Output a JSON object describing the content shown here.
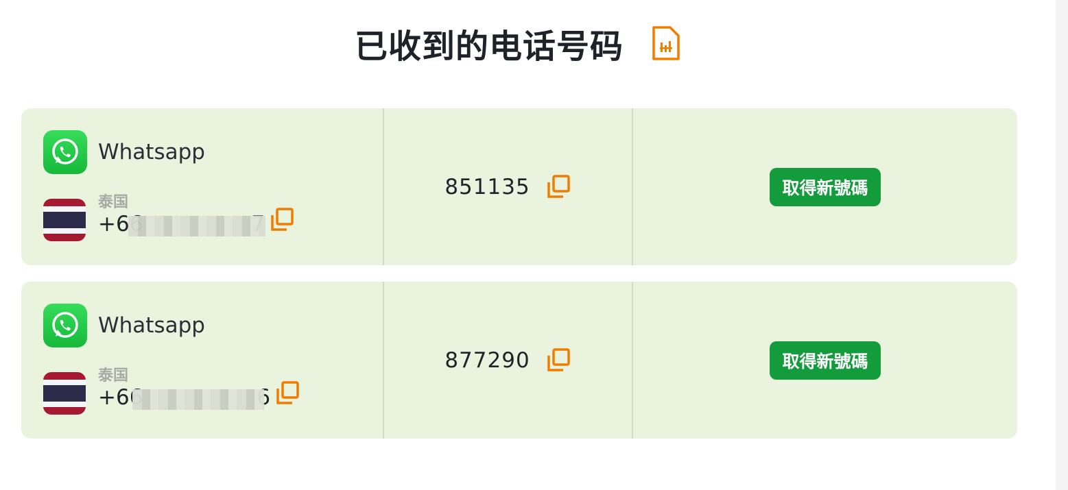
{
  "header": {
    "title": "已收到的电话号码",
    "icon": "sim-card-icon",
    "accent_color": "#f07d00"
  },
  "numbers": [
    {
      "app_name": "Whatsapp",
      "app_icon": "whatsapp-icon",
      "country": "泰国",
      "phone_visible_prefix": "+66",
      "phone_visible_suffix": "7",
      "code": "851135",
      "new_number_label": "取得新號碼"
    },
    {
      "app_name": "Whatsapp",
      "app_icon": "whatsapp-icon",
      "country": "泰国",
      "phone_visible_prefix": "+66",
      "phone_visible_suffix": "6",
      "code": "877290",
      "new_number_label": "取得新號碼"
    }
  ],
  "colors": {
    "card_bg": "#e9f3dd",
    "button_bg": "#139b3c",
    "copy_icon": "#f07d00"
  }
}
